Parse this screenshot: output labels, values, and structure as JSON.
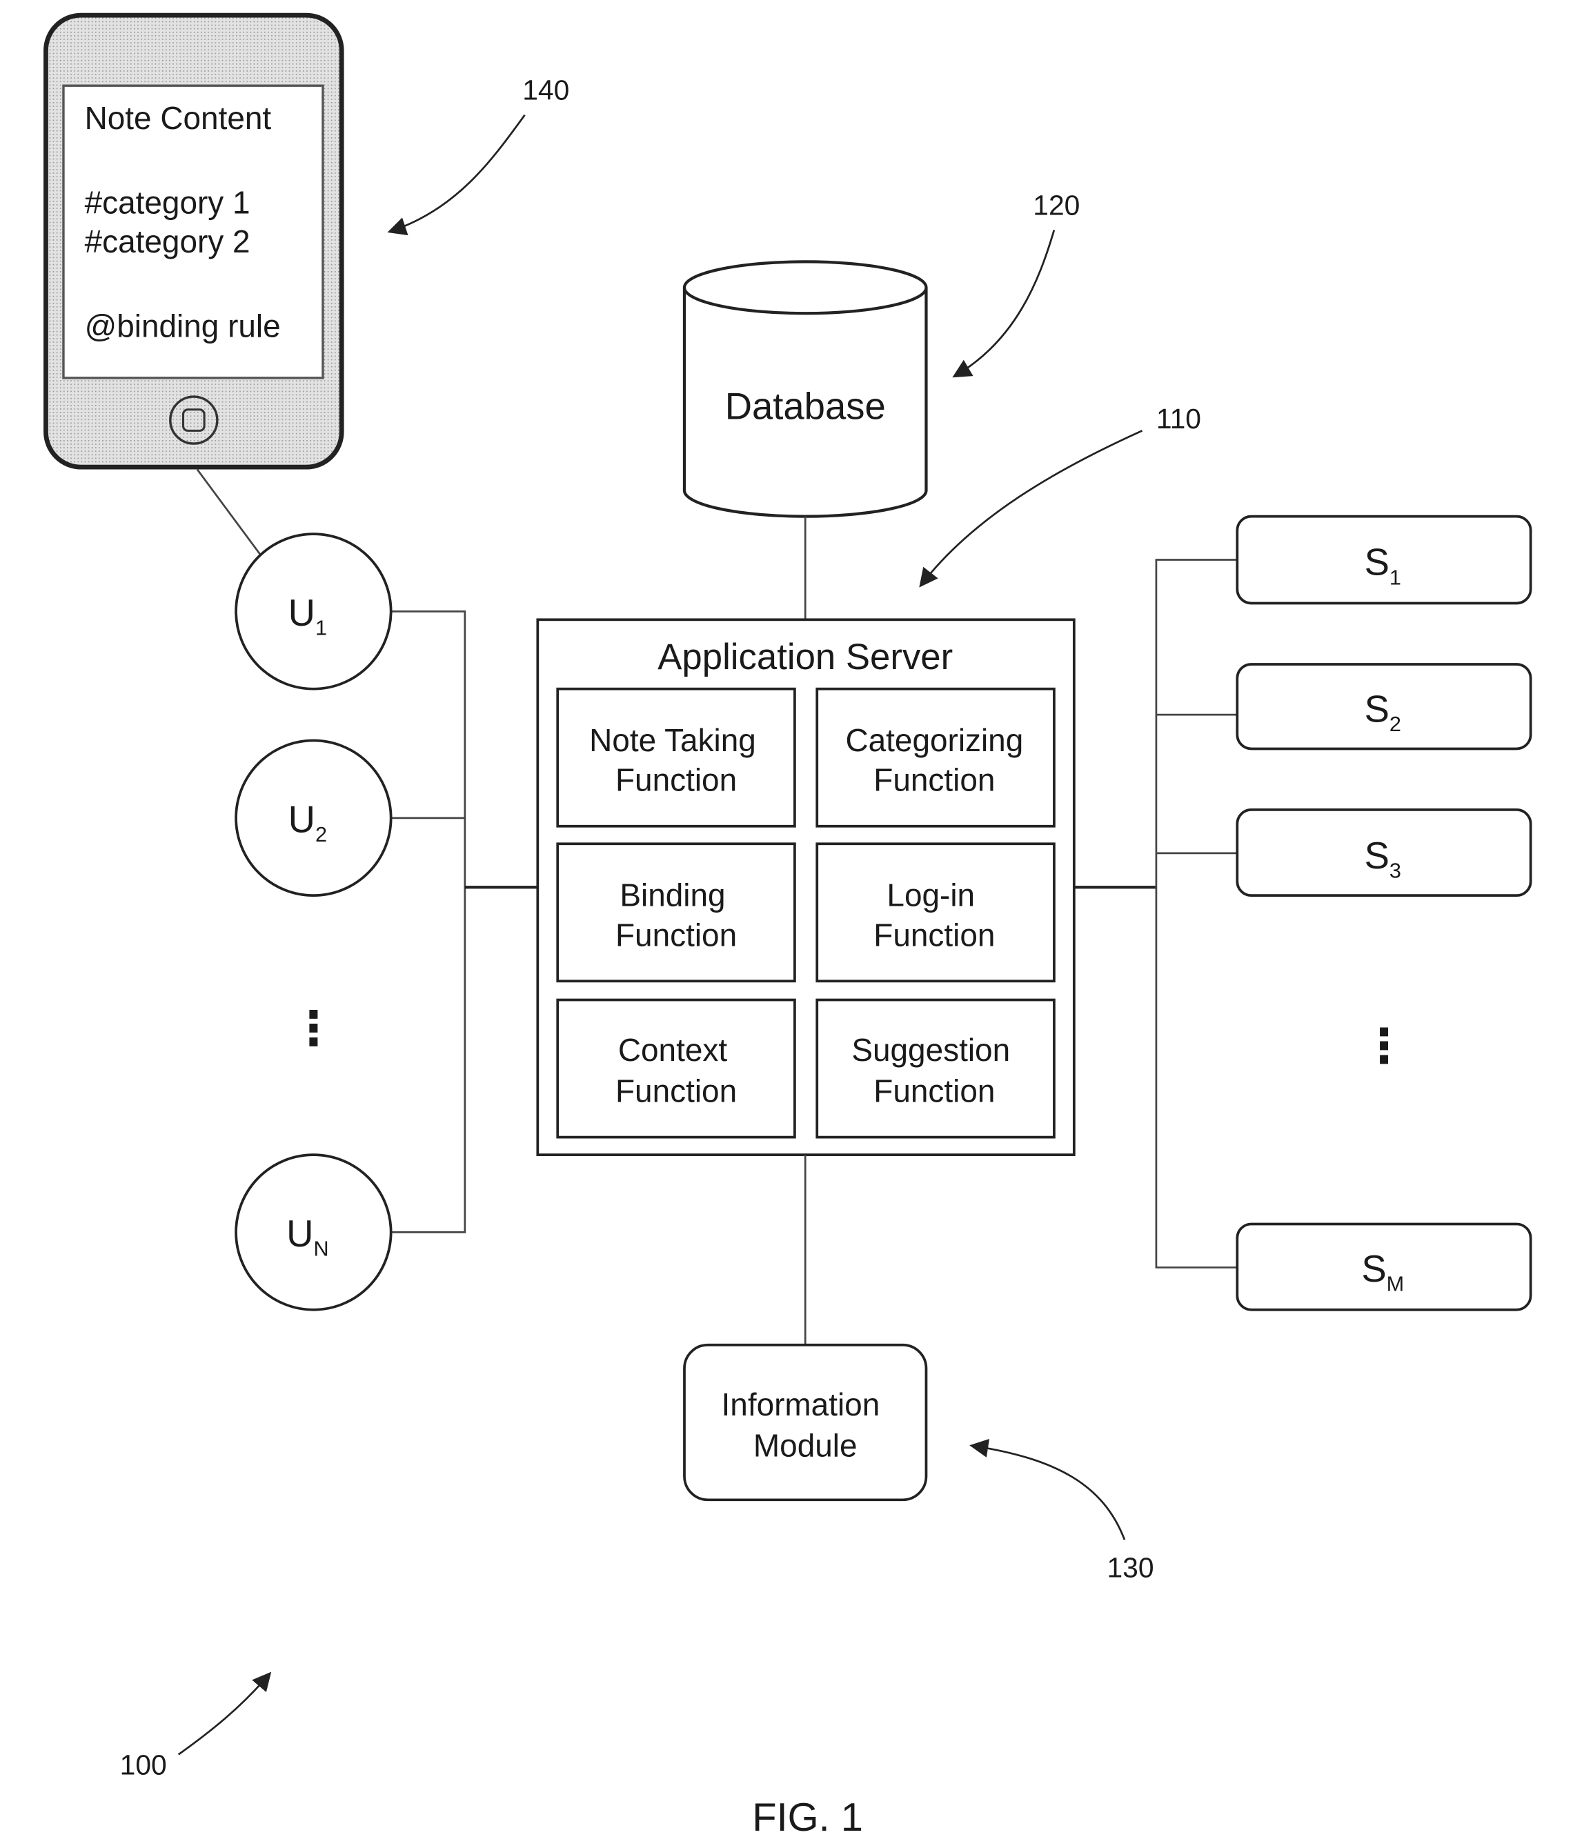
{
  "figure": {
    "caption": "FIG. 1",
    "ref_system": "100"
  },
  "device": {
    "ref": "140",
    "lines": [
      "Note Content",
      "#category 1",
      "#category 2",
      "@binding rule"
    ]
  },
  "database": {
    "label": "Database",
    "ref": "120"
  },
  "server": {
    "ref": "110",
    "title": "Application Server",
    "functions": [
      {
        "line1": "Note Taking",
        "line2": "Function"
      },
      {
        "line1": "Categorizing",
        "line2": "Function"
      },
      {
        "line1": "Binding",
        "line2": "Function"
      },
      {
        "line1": "Log-in",
        "line2": "Function"
      },
      {
        "line1": "Context",
        "line2": "Function"
      },
      {
        "line1": "Suggestion",
        "line2": "Function"
      }
    ]
  },
  "info_module": {
    "line1": "Information",
    "line2": "Module",
    "ref": "130"
  },
  "users": [
    {
      "base": "U",
      "sub": "1"
    },
    {
      "base": "U",
      "sub": "2"
    },
    {
      "base": "U",
      "sub": "N"
    }
  ],
  "services": [
    {
      "base": "S",
      "sub": "1"
    },
    {
      "base": "S",
      "sub": "2"
    },
    {
      "base": "S",
      "sub": "3"
    },
    {
      "base": "S",
      "sub": "M"
    }
  ],
  "ellipsis": "⋮"
}
